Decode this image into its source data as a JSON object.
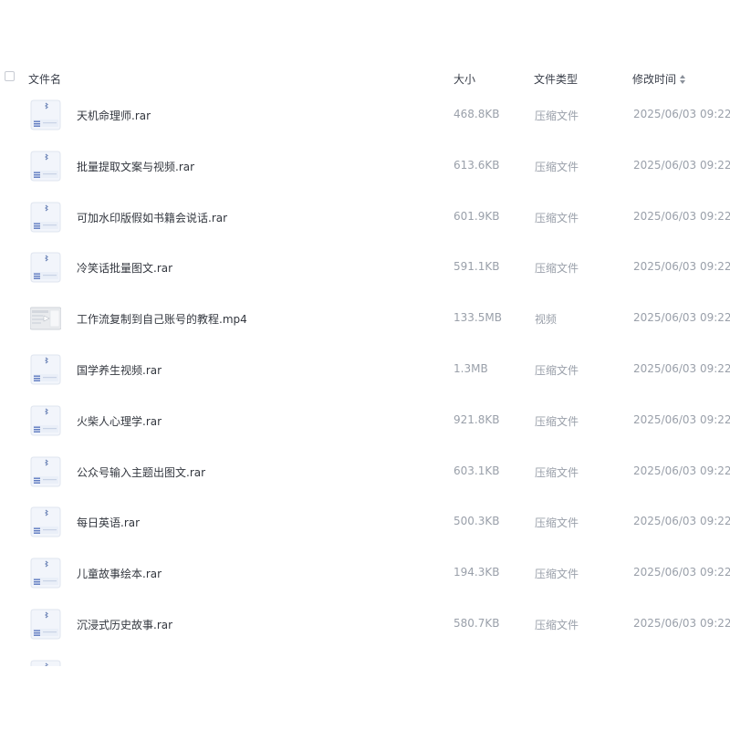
{
  "header": {
    "name": "文件名",
    "size": "大小",
    "type": "文件类型",
    "modified": "修改时间"
  },
  "files": [
    {
      "name": "天机命理师.rar",
      "size": "468.8KB",
      "type": "压缩文件",
      "modified": "2025/06/03 09:22",
      "icon": "archive-file-icon"
    },
    {
      "name": "批量提取文案与视频.rar",
      "size": "613.6KB",
      "type": "压缩文件",
      "modified": "2025/06/03 09:22",
      "icon": "archive-file-icon"
    },
    {
      "name": "可加水印版假如书籍会说话.rar",
      "size": "601.9KB",
      "type": "压缩文件",
      "modified": "2025/06/03 09:22",
      "icon": "archive-file-icon"
    },
    {
      "name": "冷笑话批量图文.rar",
      "size": "591.1KB",
      "type": "压缩文件",
      "modified": "2025/06/03 09:22",
      "icon": "archive-file-icon"
    },
    {
      "name": "工作流复制到自己账号的教程.mp4",
      "size": "133.5MB",
      "type": "视频",
      "modified": "2025/06/03 09:22",
      "icon": "video-thumbnail-icon"
    },
    {
      "name": "国学养生视频.rar",
      "size": "1.3MB",
      "type": "压缩文件",
      "modified": "2025/06/03 09:22",
      "icon": "archive-file-icon"
    },
    {
      "name": "火柴人心理学.rar",
      "size": "921.8KB",
      "type": "压缩文件",
      "modified": "2025/06/03 09:22",
      "icon": "archive-file-icon"
    },
    {
      "name": "公众号输入主题出图文.rar",
      "size": "603.1KB",
      "type": "压缩文件",
      "modified": "2025/06/03 09:22",
      "icon": "archive-file-icon"
    },
    {
      "name": "每日英语.rar",
      "size": "500.3KB",
      "type": "压缩文件",
      "modified": "2025/06/03 09:22",
      "icon": "archive-file-icon"
    },
    {
      "name": "儿童故事绘本.rar",
      "size": "194.3KB",
      "type": "压缩文件",
      "modified": "2025/06/03 09:22",
      "icon": "archive-file-icon"
    },
    {
      "name": "沉浸式历史故事.rar",
      "size": "580.7KB",
      "type": "压缩文件",
      "modified": "2025/06/03 09:22",
      "icon": "archive-file-icon"
    }
  ]
}
